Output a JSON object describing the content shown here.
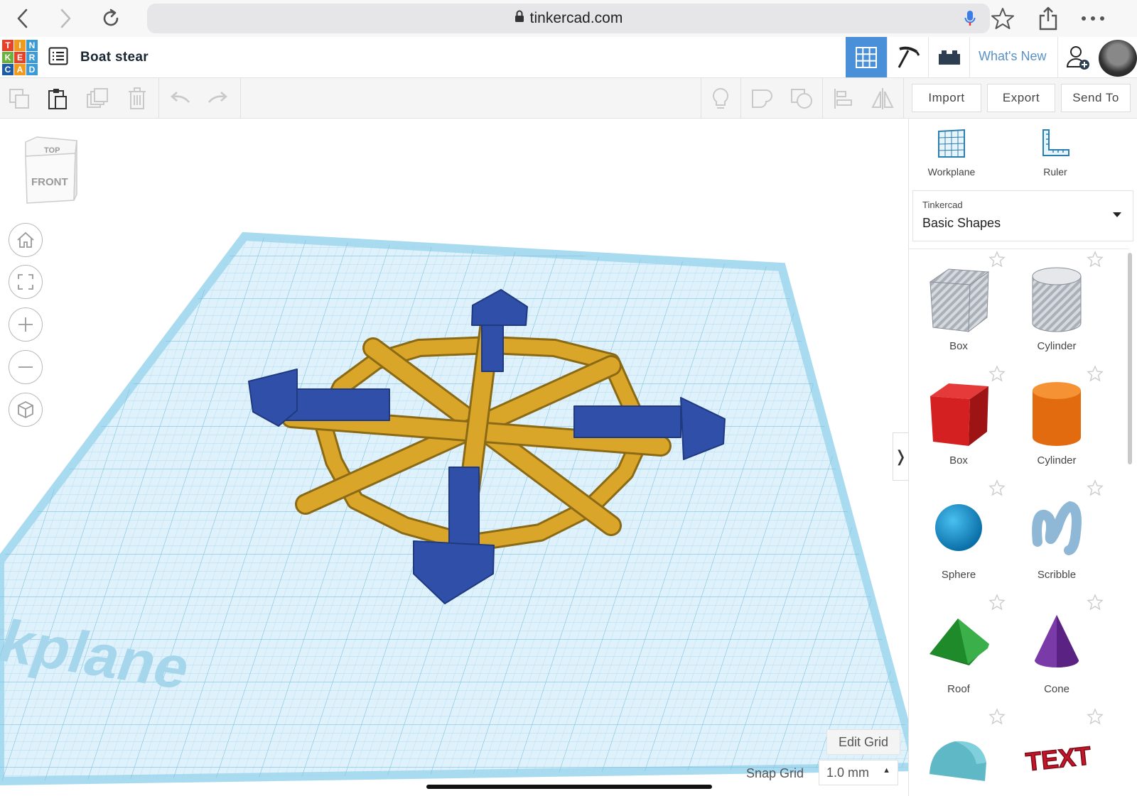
{
  "browser": {
    "url": "tinkercad.com",
    "icons": [
      "back-icon",
      "forward-icon",
      "reload-icon",
      "lock-icon",
      "microphone-icon",
      "bookmark-star-icon",
      "share-icon",
      "more-icon"
    ]
  },
  "app": {
    "logo_letters": [
      "T",
      "I",
      "N",
      "K",
      "E",
      "R",
      "C",
      "A",
      "D"
    ],
    "logo_colors": [
      "#e8412a",
      "#f29a1f",
      "#3a9bd9",
      "#6ab23c",
      "#e8412a",
      "#3a9bd9",
      "#1d5ba8",
      "#f29a1f",
      "#3a9bd9"
    ],
    "design_title": "Boat stear",
    "whats_new": "What's New",
    "header_tabs": [
      "3d-design-grid-icon",
      "pickaxe-icon",
      "brick-icon"
    ],
    "accent": "#4a90d9"
  },
  "toolbar": {
    "import_label": "Import",
    "export_label": "Export",
    "send_to_label": "Send To"
  },
  "workspace": {
    "viewcube_top": "TOP",
    "viewcube_front": "FRONT",
    "workplane_watermark": "Workplane",
    "edit_grid_label": "Edit Grid",
    "snap_grid_label": "Snap Grid",
    "snap_grid_value": "1.0 mm",
    "collapse_glyph": "❭"
  },
  "panel": {
    "tools": [
      {
        "label": "Workplane",
        "icon": "workplane-icon"
      },
      {
        "label": "Ruler",
        "icon": "ruler-icon"
      }
    ],
    "library_source": "Tinkercad",
    "library_name": "Basic Shapes",
    "shapes": [
      {
        "label": "Box",
        "icon": "box-hole-icon"
      },
      {
        "label": "Cylinder",
        "icon": "cylinder-hole-icon"
      },
      {
        "label": "Box",
        "icon": "box-icon"
      },
      {
        "label": "Cylinder",
        "icon": "cylinder-icon"
      },
      {
        "label": "Sphere",
        "icon": "sphere-icon"
      },
      {
        "label": "Scribble",
        "icon": "scribble-icon"
      },
      {
        "label": "Roof",
        "icon": "roof-icon"
      },
      {
        "label": "Cone",
        "icon": "cone-icon"
      },
      {
        "label": "",
        "icon": "round-roof-icon"
      },
      {
        "label": "",
        "icon": "text-icon"
      }
    ],
    "text_shape_glyph": "TEXT"
  }
}
